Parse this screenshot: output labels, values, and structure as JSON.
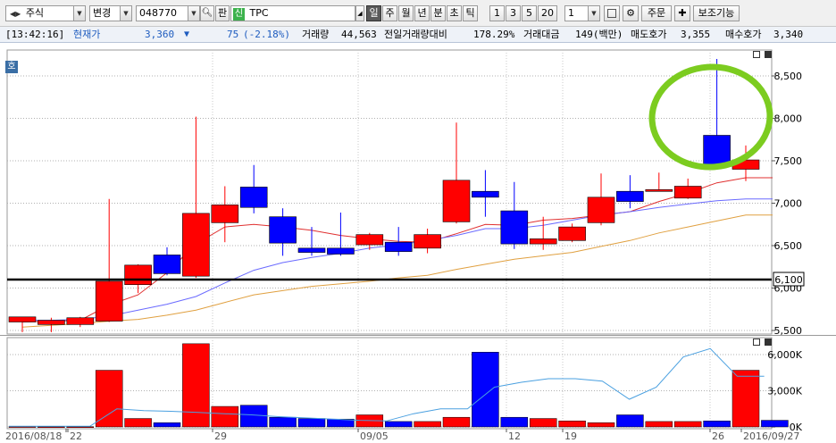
{
  "toolbar": {
    "market": "주식",
    "change_label": "변경",
    "code": "048770",
    "plate_label": "판",
    "new_badge": "신",
    "name": "TPC",
    "periods": [
      "일",
      "주",
      "월",
      "년",
      "분",
      "초",
      "틱"
    ],
    "active_period": "일",
    "intervals": [
      "1",
      "3",
      "5",
      "20"
    ],
    "count_value": "1",
    "order_label": "주문",
    "aux_label": "보조기능"
  },
  "info": {
    "time": "[13:42:16]",
    "price_label": "현재가",
    "price": "3,360",
    "direction": "▼",
    "change": "75",
    "change_pct": "(-2.18%)",
    "volume_label": "거래량",
    "volume": "44,563",
    "prev_ratio_label": "전일거래량대비",
    "prev_ratio": "178.29%",
    "amount_label": "거래대금",
    "amount": "149(백만)",
    "ask_label": "매도호가",
    "ask": "3,355",
    "bid_label": "매수호가",
    "bid": "3,340"
  },
  "price_chart": {
    "corner_label": "호",
    "ref_line_label": "6,100",
    "y_ticks": [
      "8,500",
      "8,000",
      "7,500",
      "7,000",
      "6,500",
      "6,000",
      "5,500"
    ]
  },
  "volume_chart": {
    "y_ticks": [
      "6,000K",
      "3,000K",
      "0K"
    ],
    "x_labels": [
      "2016/08/18",
      "22",
      "29",
      "09/05",
      "12",
      "19",
      "26",
      "2016/09/27"
    ]
  },
  "colors": {
    "up": "#ff0000",
    "down": "#0000ff",
    "ma_short": "#e03030",
    "ma_mid": "#6a6aff",
    "ma_long": "#e0a040",
    "volume_line": "#4aa0e0",
    "highlight": "#7ccc20"
  },
  "chart_data": [
    {
      "type": "candlestick",
      "title": "",
      "xlabel": "",
      "ylabel": "",
      "ylim": [
        5500,
        8700
      ],
      "reference_line": 6100,
      "series": [
        {
          "values": [
            {
              "o": 5600,
              "h": 5660,
              "l": 5480,
              "c": 5660
            },
            {
              "o": 5570,
              "h": 5650,
              "l": 5480,
              "c": 5620
            },
            {
              "o": 5570,
              "h": 5660,
              "l": 5540,
              "c": 5650
            },
            {
              "o": 5610,
              "h": 7050,
              "l": 5600,
              "c": 6080
            },
            {
              "o": 6040,
              "h": 6280,
              "l": 5940,
              "c": 6270
            },
            {
              "o": 6390,
              "h": 6480,
              "l": 6150,
              "c": 6170
            },
            {
              "o": 6140,
              "h": 8020,
              "l": 6120,
              "c": 6880
            },
            {
              "o": 6770,
              "h": 7200,
              "l": 6540,
              "c": 6980
            },
            {
              "o": 7190,
              "h": 7450,
              "l": 6880,
              "c": 6950
            },
            {
              "o": 6840,
              "h": 6940,
              "l": 6380,
              "c": 6530
            },
            {
              "o": 6470,
              "h": 6720,
              "l": 6380,
              "c": 6420
            },
            {
              "o": 6470,
              "h": 6890,
              "l": 6380,
              "c": 6400
            },
            {
              "o": 6510,
              "h": 6650,
              "l": 6450,
              "c": 6630
            },
            {
              "o": 6540,
              "h": 6720,
              "l": 6380,
              "c": 6430
            },
            {
              "o": 6470,
              "h": 6700,
              "l": 6410,
              "c": 6630
            },
            {
              "o": 6780,
              "h": 7950,
              "l": 6760,
              "c": 7270
            },
            {
              "o": 7140,
              "h": 7390,
              "l": 6840,
              "c": 7070
            },
            {
              "o": 6910,
              "h": 7250,
              "l": 6460,
              "c": 6520
            },
            {
              "o": 6520,
              "h": 6840,
              "l": 6450,
              "c": 6580
            },
            {
              "o": 6560,
              "h": 6760,
              "l": 6540,
              "c": 6720
            },
            {
              "o": 6770,
              "h": 7350,
              "l": 6740,
              "c": 7070
            },
            {
              "o": 7140,
              "h": 7330,
              "l": 6940,
              "c": 7020
            },
            {
              "o": 7150,
              "h": 7360,
              "l": 7140,
              "c": 7160
            },
            {
              "o": 7060,
              "h": 7290,
              "l": 7050,
              "c": 7200
            },
            {
              "o": 7800,
              "h": 8700,
              "l": 7400,
              "c": 7450
            },
            {
              "o": 7400,
              "h": 7680,
              "l": 7260,
              "c": 7510
            }
          ]
        },
        {
          "name": "",
          "values": [
            5600,
            5610,
            5620,
            5800,
            5920,
            6180,
            6520,
            6720,
            6750,
            6720,
            6680,
            6620,
            6580,
            6550,
            6540,
            6640,
            6750,
            6740,
            6800,
            6820,
            6860,
            6900,
            7020,
            7120,
            7240,
            7300
          ]
        },
        {
          "name": "",
          "values": [
            5620,
            5620,
            5630,
            5670,
            5740,
            5810,
            5900,
            6060,
            6210,
            6300,
            6360,
            6410,
            6470,
            6510,
            6560,
            6620,
            6700,
            6700,
            6740,
            6800,
            6860,
            6900,
            6950,
            6990,
            7030,
            7050
          ]
        },
        {
          "name": "",
          "values": [
            5540,
            5560,
            5580,
            5610,
            5630,
            5680,
            5740,
            5830,
            5920,
            5970,
            6020,
            6050,
            6080,
            6120,
            6150,
            6220,
            6280,
            6340,
            6380,
            6420,
            6490,
            6560,
            6650,
            6720,
            6790,
            6860
          ]
        }
      ]
    },
    {
      "type": "bar",
      "title": "",
      "xlabel": "",
      "ylabel": "",
      "ylim": [
        0,
        7000
      ],
      "unit": "K",
      "series": [
        {
          "values": [
            30,
            20,
            20,
            4700,
            700,
            350,
            6900,
            1700,
            1800,
            800,
            700,
            650,
            1000,
            450,
            450,
            800,
            6200,
            800,
            700,
            500,
            350,
            1000,
            450,
            450,
            500,
            4700,
            550
          ]
        },
        {
          "name": "",
          "values": [
            50,
            50,
            60,
            50,
            1500,
            1350,
            1300,
            1200,
            1100,
            1000,
            850,
            750,
            650,
            550,
            500,
            1100,
            1500,
            1500,
            3300,
            3700,
            4000,
            4000,
            3800,
            2300,
            3300,
            5800,
            6500,
            4200,
            4200
          ]
        }
      ]
    }
  ]
}
